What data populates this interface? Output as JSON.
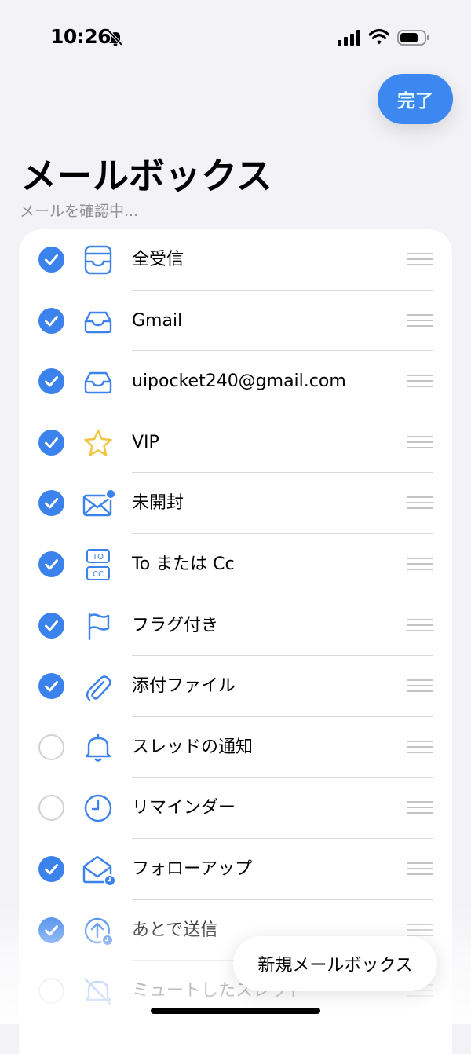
{
  "status_bar": {
    "time": "10:26"
  },
  "header": {
    "done_label": "完了",
    "title": "メールボックス",
    "subtitle": "メールを確認中..."
  },
  "mailboxes": [
    {
      "label": "全受信",
      "checked": true,
      "icon": "tray-stack-icon"
    },
    {
      "label": "Gmail",
      "checked": true,
      "icon": "inbox-tray-icon"
    },
    {
      "label": "uipocket240@gmail.com",
      "checked": true,
      "icon": "inbox-tray-icon"
    },
    {
      "label": "VIP",
      "checked": true,
      "icon": "star-icon"
    },
    {
      "label": "未開封",
      "checked": true,
      "icon": "envelope-badge-icon"
    },
    {
      "label": "To または Cc",
      "checked": true,
      "icon": "to-cc-icon"
    },
    {
      "label": "フラグ付き",
      "checked": true,
      "icon": "flag-icon"
    },
    {
      "label": "添付ファイル",
      "checked": true,
      "icon": "paperclip-icon"
    },
    {
      "label": "スレッドの通知",
      "checked": false,
      "icon": "bell-icon"
    },
    {
      "label": "リマインダー",
      "checked": false,
      "icon": "clock-icon"
    },
    {
      "label": "フォローアップ",
      "checked": true,
      "icon": "envelope-open-clock-icon"
    },
    {
      "label": "あとで送信",
      "checked": true,
      "icon": "send-later-icon"
    },
    {
      "label": "ミュートしたスレッド",
      "checked": false,
      "icon": "bell-slash-icon"
    }
  ],
  "new_mailbox_label": "新規メールボックス",
  "colors": {
    "accent": "#3b82ec",
    "done_button_bg": "#3c88f0",
    "done_button_text": "#e8fbff",
    "star": "#f2c440",
    "background": "#f2f2f7"
  }
}
